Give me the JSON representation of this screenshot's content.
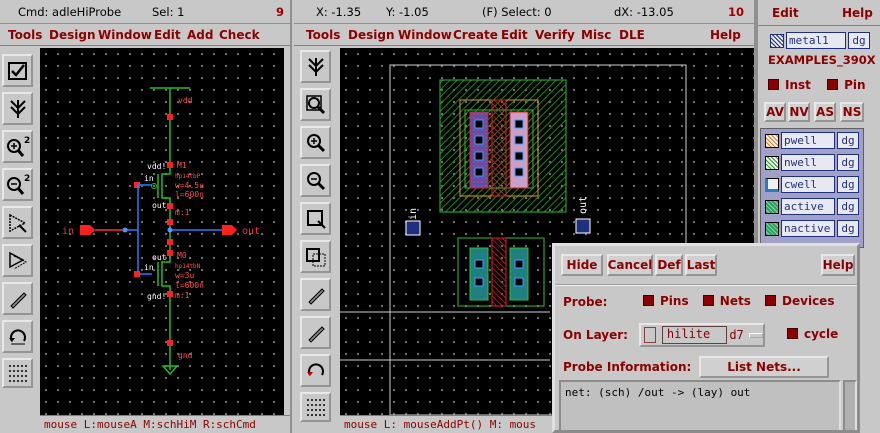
{
  "schematic_window": {
    "cmd": "Cmd: adleHiProbe",
    "sel": "Sel: 1",
    "window_number": "9",
    "menu": [
      "Tools",
      "Design",
      "Window",
      "Edit",
      "Add",
      "Check"
    ],
    "prompt": "mouse L:mouseA M:schHiM R:schCmd",
    "schematic": {
      "vdd_label": "vdd",
      "gnd_label": "gnd",
      "in_pin": "in",
      "out_pin": "out",
      "m1": {
        "name": "M1",
        "model": "hp14tbP",
        "w": "w=4.5u",
        "l": "l=600n",
        "m": "m:1",
        "d": "vdd!",
        "g": "in",
        "s": "out"
      },
      "m0": {
        "name": "M0",
        "model": "hp14tbN",
        "w": "w=3u",
        "l": "l=600n",
        "m": "m:1",
        "d": "out",
        "g": "in",
        "s": "gnd!"
      }
    },
    "icons": [
      "select-icon",
      "stretch-icon",
      "zoom-in-icon",
      "zoom-out-icon",
      "move-icon",
      "copy-icon",
      "pencil-icon",
      "undo-icon",
      "grid-icon"
    ]
  },
  "layout_window": {
    "x": "X: -1.35",
    "y": "Y: -1.05",
    "mode": "(F) Select: 0",
    "dx": "dX: -13.05",
    "window_number": "10",
    "menu": [
      "Tools",
      "Design",
      "Window",
      "Create",
      "Edit",
      "Verify",
      "Misc",
      "DLE",
      "Help"
    ],
    "prompt": "mouse L: mouseAddPt()   M: mous",
    "pin_in": "in",
    "pin_out": "out",
    "icons": [
      "stretch-icon",
      "zoom-fit-icon",
      "zoom-in-icon",
      "zoom-out-icon",
      "box-icon",
      "copy-icon",
      "pencil-icon",
      "pencil-icon",
      "undo-icon",
      "grid-icon"
    ]
  },
  "lsw": {
    "edit_label": "Edit",
    "help_label": "Help",
    "current_layer": "metal1",
    "current_purpose": "dg",
    "tech": "EXAMPLES_390X",
    "inst_label": "Inst",
    "pin_label": "Pin",
    "buttons": [
      "AV",
      "NV",
      "AS",
      "NS"
    ],
    "layers": [
      {
        "name": "pwell",
        "purpose": "dg",
        "color": "#e08020"
      },
      {
        "name": "nwell",
        "purpose": "dg",
        "color": "#30a030"
      },
      {
        "name": "cwell",
        "purpose": "dg",
        "color": "#2080c0"
      },
      {
        "name": "active",
        "purpose": "dg",
        "color": "#30a060"
      },
      {
        "name": "nactive",
        "purpose": "dg",
        "color": "#30a060"
      }
    ]
  },
  "probe": {
    "hide": "Hide",
    "cancel": "Cancel",
    "def": "Def",
    "last": "Last",
    "help": "Help",
    "probe_label": "Probe:",
    "pins": "Pins",
    "nets": "Nets",
    "devices": "Devices",
    "on_layer_label": "On Layer:",
    "layer_name": "hilite",
    "layer_purpose": "d7",
    "cycle": "cycle",
    "info_label": "Probe Information:",
    "list_nets": "List Nets...",
    "info_text": "net: (sch) /out -> (lay) out"
  }
}
